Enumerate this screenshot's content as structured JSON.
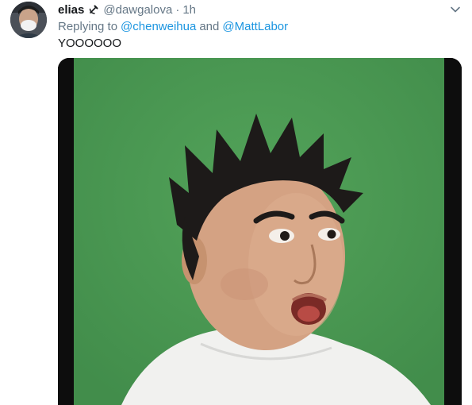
{
  "tweet": {
    "author": {
      "display_name": "elias",
      "handle": "@dawgalova",
      "avatar_icon": "avatar-masked-person-icon",
      "name_emoji_icon": "hammer-sickle-icon"
    },
    "separator": "·",
    "time": "1h",
    "reply": {
      "prefix": "Replying to",
      "mentions": [
        "@chenweihua",
        "@MattLabor"
      ],
      "joiner": "and"
    },
    "text": "YOOOOOO",
    "media": {
      "type": "gif",
      "icon": "gif-face-icon"
    },
    "menu_icon": "chevron-down-icon"
  },
  "colors": {
    "accent": "#1b95e0",
    "secondary_text": "#657786",
    "primary_text": "#14171a",
    "media_background": "#4a9a52"
  }
}
